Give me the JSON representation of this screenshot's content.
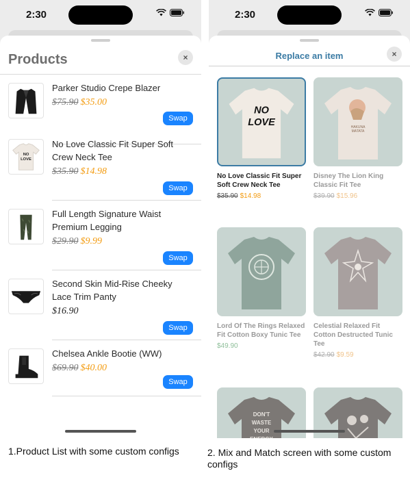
{
  "status": {
    "time": "2:30"
  },
  "product_list": {
    "title": "Products",
    "close_icon": "×",
    "items": [
      {
        "name": "Parker Studio Crepe Blazer",
        "old_price": "$75.90",
        "new_price": "$35.00",
        "price": "",
        "swap_label": "Swap",
        "icon": "blazer-icon"
      },
      {
        "name": "No Love Classic Fit Super Soft Crew Neck Tee",
        "old_price": "$35.90",
        "new_price": "$14.98",
        "price": "",
        "swap_label": "Swap",
        "icon": "tshirt-icon"
      },
      {
        "name": "Full Length Signature Waist Premium Legging",
        "old_price": "$29.90",
        "new_price": "$9.99",
        "price": "",
        "swap_label": "Swap",
        "icon": "legging-icon"
      },
      {
        "name": "Second Skin Mid-Rise Cheeky Lace Trim Panty",
        "old_price": "",
        "new_price": "",
        "price": "$16.90",
        "swap_label": "Swap",
        "icon": "panty-icon"
      },
      {
        "name": "Chelsea Ankle Bootie (WW)",
        "old_price": "$69.90",
        "new_price": "$40.00",
        "price": "",
        "swap_label": "Swap",
        "icon": "boot-icon"
      }
    ]
  },
  "replace": {
    "title": "Replace an item",
    "close_icon": "×",
    "items": [
      {
        "name": "No Love Classic Fit Super Soft Crew Neck Tee",
        "old_price": "$35.90",
        "new_price": "$14.98",
        "price": "",
        "tee_text": "NO LOVE",
        "selected": true
      },
      {
        "name": "Disney The Lion King Classic Fit Tee",
        "old_price": "$39.90",
        "new_price": "$15.96",
        "price": "",
        "tee_text": "HAKUNA MATATA"
      },
      {
        "name": "Lord Of The Rings Relaxed Fit Cotton Boxy Tunic Tee",
        "old_price": "",
        "new_price": "",
        "price": "$49.90",
        "tee_text": ""
      },
      {
        "name": "Celestial Relaxed Fit Cotton Destructed Tunic Tee",
        "old_price": "$42.90",
        "new_price": "$9.59",
        "price": "",
        "tee_text": ""
      },
      {
        "tee_text": "DON'T WASTE YOUR ENERGY"
      },
      {
        "tee_text": ""
      }
    ]
  },
  "captions": {
    "left": "1.Product List with some custom configs",
    "right": "2. Mix and Match screen with some custom configs"
  },
  "colors": {
    "accent_blue": "#1a84ff",
    "sale_orange": "#f39c12",
    "title_blue": "#3b7ba4"
  }
}
